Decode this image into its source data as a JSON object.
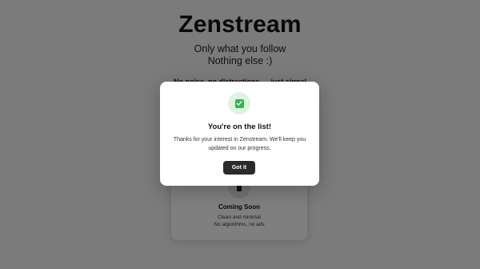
{
  "hero": {
    "title": "Zenstream",
    "subtitle_line1": "Only what you follow",
    "subtitle_line2": "Nothing else :)",
    "tagline": "No noise, no distractions — just signal"
  },
  "coming_card": {
    "icon": "phone-icon",
    "title": "Coming Soon",
    "line1": "Clean and minimal",
    "line2": "No algorithms, no ads"
  },
  "modal": {
    "icon": "check-icon",
    "title": "You're on the list!",
    "message": "Thanks for your interest in Zenstream. We'll keep you updated on our progress.",
    "button_label": "Got it"
  },
  "colors": {
    "overlay": "rgba(0,0,0,0.5)",
    "check_green": "#2fb84a",
    "check_bg": "#dcf5dc",
    "button_bg": "#2a2a2a"
  }
}
